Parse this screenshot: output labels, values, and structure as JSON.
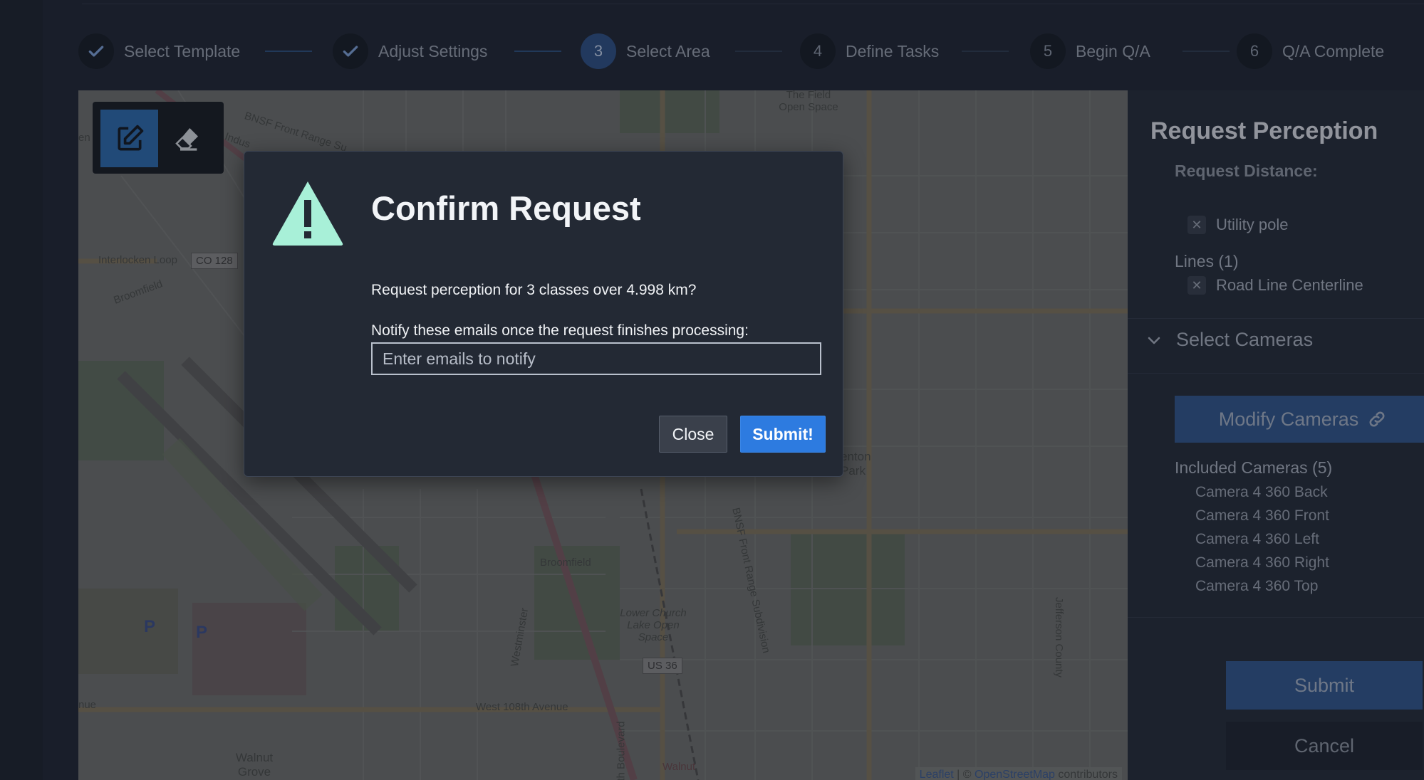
{
  "stepper": {
    "steps": [
      {
        "label": "Select Template",
        "marker": "✓",
        "state": "done"
      },
      {
        "label": "Adjust Settings",
        "marker": "✓",
        "state": "done"
      },
      {
        "label": "Select Area",
        "marker": "3",
        "state": "active"
      },
      {
        "label": "Define Tasks",
        "marker": "4",
        "state": "pending"
      },
      {
        "label": "Begin Q/A",
        "marker": "5",
        "state": "pending"
      },
      {
        "label": "Q/A Complete",
        "marker": "6",
        "state": "pending"
      }
    ]
  },
  "map": {
    "labels": {
      "interlocken": "Interlocken Loop",
      "broomfield_nw": "Broomfield",
      "broomfield_center": "Broomfield",
      "field_open_space": "The Field Open Space",
      "lower_church": "Lower Church Lake Open Space",
      "west_108th": "West 108th Avenue",
      "westminster": "Westminster",
      "walnut_grove": "Walnut Grove",
      "walnut": "Walnut",
      "jefferson_county": "Jefferson County",
      "front_range": "BNSF Front Range Subdivision",
      "front_range_top": "BNSF Front Range Su",
      "industrial": "Indus",
      "benton_park": "enton Park",
      "boulevard": "th Boulevard",
      "nue": "nue",
      "en": "en"
    },
    "shields": {
      "co128": "CO 128",
      "us36": "US 36"
    },
    "parking": [
      "P",
      "P"
    ],
    "attribution": {
      "leaflet": "Leaflet",
      "separator": " | © ",
      "osm": "OpenStreetMap",
      "contributors": " contributors"
    }
  },
  "draw_toolbar": {
    "pen": "edit-icon",
    "eraser": "eraser-icon"
  },
  "panel": {
    "title": "Request Perception",
    "distance_label": "Request Distance:",
    "points_chip": "Utility pole",
    "lines_header": "Lines (1)",
    "lines_chip": "Road Line Centerline",
    "select_cameras": "Select Cameras",
    "modify_cameras": "Modify Cameras",
    "included_header": "Included Cameras (5)",
    "cameras": [
      "Camera 4 360 Back",
      "Camera 4 360 Front",
      "Camera 4 360 Left",
      "Camera 4 360 Right",
      "Camera 4 360 Top"
    ],
    "submit": "Submit",
    "cancel": "Cancel"
  },
  "modal": {
    "title": "Confirm Request",
    "question": "Request perception for 3 classes over 4.998 km?",
    "notify_label": "Notify these emails once the request finishes processing:",
    "email_placeholder": "Enter emails to notify",
    "email_value": "",
    "close": "Close",
    "submit": "Submit!"
  },
  "colors": {
    "accent": "#2d7be0",
    "warning": "#a8f0d8",
    "modal_bg": "#232934",
    "page_bg": "#1e2532"
  }
}
